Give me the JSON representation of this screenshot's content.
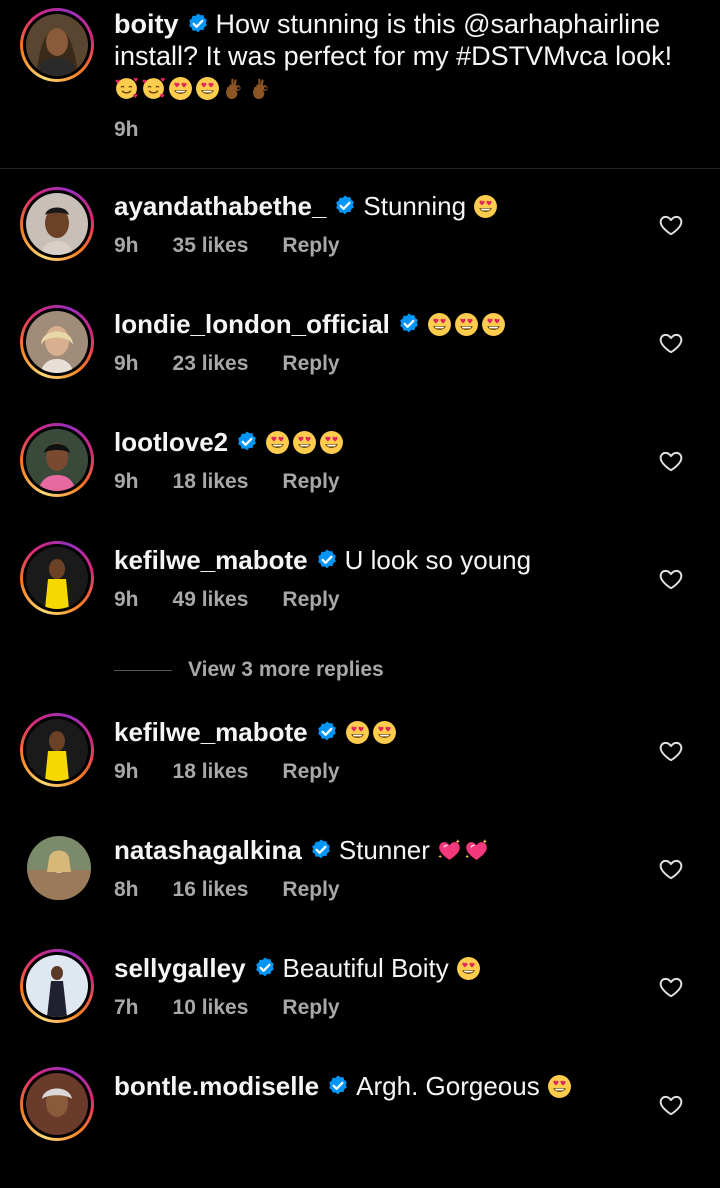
{
  "post": {
    "username": "boity",
    "caption": "How stunning is this @sarhaphairline install? It was perfect for my #DSTVMvca look!",
    "time": "9h",
    "emojis": [
      "smiling-face-with-hearts",
      "smiling-face-with-hearts",
      "heart-eyes",
      "heart-eyes",
      "ok-hand-dark",
      "ok-hand-dark"
    ]
  },
  "comments": [
    {
      "username": "ayandathabethe_",
      "text": "Stunning",
      "emojis": [
        "heart-eyes"
      ],
      "time": "9h",
      "likes": "35 likes",
      "reply": "Reply"
    },
    {
      "username": "londie_london_official",
      "text": "",
      "emojis": [
        "heart-eyes",
        "heart-eyes",
        "heart-eyes"
      ],
      "time": "9h",
      "likes": "23 likes",
      "reply": "Reply"
    },
    {
      "username": "lootlove2",
      "text": "",
      "emojis": [
        "heart-eyes",
        "heart-eyes",
        "heart-eyes"
      ],
      "time": "9h",
      "likes": "18 likes",
      "reply": "Reply"
    },
    {
      "username": "kefilwe_mabote",
      "text": "U look so young",
      "emojis": [],
      "time": "9h",
      "likes": "49 likes",
      "reply": "Reply"
    },
    {
      "username": "kefilwe_mabote",
      "text": "",
      "emojis": [
        "heart-eyes",
        "heart-eyes"
      ],
      "time": "9h",
      "likes": "18 likes",
      "reply": "Reply"
    },
    {
      "username": "natashagalkina",
      "text": "Stunner",
      "emojis": [
        "sparkling-heart",
        "sparkling-heart"
      ],
      "time": "8h",
      "likes": "16 likes",
      "reply": "Reply"
    },
    {
      "username": "sellygalley",
      "text": "Beautiful Boity",
      "emojis": [
        "heart-eyes"
      ],
      "time": "7h",
      "likes": "10 likes",
      "reply": "Reply"
    },
    {
      "username": "bontle.modiselle",
      "text": "Argh. Gorgeous",
      "emojis": [
        "heart-eyes"
      ],
      "time": "",
      "likes": "",
      "reply": ""
    }
  ],
  "view_more_replies": "View 3 more replies",
  "icons": {
    "verified": "verified-badge-icon",
    "like": "heart-outline-icon"
  },
  "colors": {
    "background": "#000000",
    "text": "#f5f5f5",
    "meta": "#a8a8a8",
    "verified": "#0095f6"
  }
}
